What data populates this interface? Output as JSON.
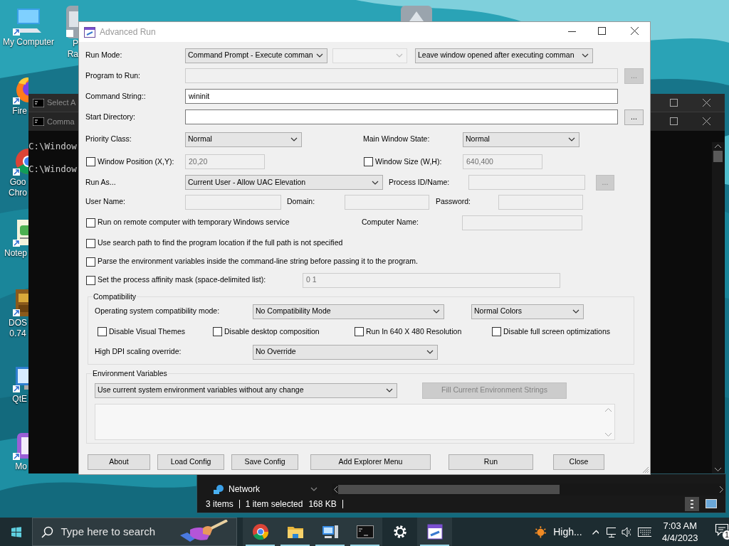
{
  "desktop_icons": [
    {
      "kind": "computer",
      "lines": [
        "My Computer"
      ]
    },
    {
      "kind": "firefox",
      "lines": [
        "Fire"
      ]
    },
    {
      "kind": "browser",
      "lines": [
        "Goo",
        "Chro"
      ]
    },
    {
      "kind": "notepad",
      "lines": [
        "Notep"
      ]
    },
    {
      "kind": "dos",
      "lines": [
        "DOS",
        "0.74"
      ]
    },
    {
      "kind": "monitor",
      "lines": [
        "QtE"
      ]
    },
    {
      "kind": "purple",
      "lines": [
        "Mo"
      ]
    }
  ],
  "top_icon": {
    "lines": [
      "P",
      "Ra"
    ]
  },
  "console_windows": [
    {
      "title": "Select A"
    },
    {
      "title": "Comma"
    }
  ],
  "console_lines": [
    "C:\\Window",
    "C:\\Window"
  ],
  "dialog": {
    "title": "Advanced Run",
    "run_mode": {
      "label": "Run Mode:",
      "mode": {
        "value": "Command Prompt - Execute comman",
        "disabled": false
      },
      "option2": {
        "disabled": true
      },
      "window_option": {
        "value": "Leave window opened after executing comman",
        "disabled": false
      }
    },
    "program": {
      "label": "Program to Run:",
      "disabled": true,
      "browse": {
        "label": "...",
        "disabled": true
      }
    },
    "command": {
      "label": "Command String::",
      "value": "wininit",
      "disabled": false
    },
    "start_dir": {
      "label": "Start Directory:",
      "disabled": false,
      "browse": {
        "label": "...",
        "disabled": false
      }
    },
    "priority": {
      "label": "Priority Class:",
      "value": "Normal"
    },
    "main_window_state": {
      "label": "Main Window State:",
      "value": "Normal"
    },
    "window_position": {
      "label": "Window Position (X,Y):",
      "checked": false,
      "value": "20,20",
      "disabled": true
    },
    "window_size": {
      "label": "Window Size (W,H):",
      "checked": false,
      "value": "640,400",
      "disabled": true
    },
    "run_as": {
      "label": "Run As...",
      "value": "Current User - Allow UAC Elevation"
    },
    "process": {
      "label": "Process ID/Name:",
      "disabled": true,
      "browse": {
        "label": "...",
        "disabled": true
      }
    },
    "user_name": {
      "label": "User Name:",
      "disabled": true
    },
    "domain": {
      "label": "Domain:",
      "disabled": true
    },
    "password": {
      "label": "Password:",
      "disabled": true
    },
    "options": [
      {
        "label": "Run on remote computer with temporary Windows service",
        "checked": false
      },
      {
        "label": "Use search path to find the program location if the full path is not specified",
        "checked": false
      },
      {
        "label": "Parse the environment variables inside the command-line string before passing it to the program.",
        "checked": false
      },
      {
        "label": "Set the process affinity mask (space-delimited list):",
        "checked": false
      }
    ],
    "computer_name": {
      "label": "Computer Name:",
      "disabled": true
    },
    "affinity": {
      "value": "0 1",
      "disabled": true
    },
    "compatibility": {
      "title": "Compatibility",
      "os_mode": {
        "label": "Operating system compatibility mode:",
        "value": "No Compatibility Mode"
      },
      "colors": {
        "value": "Normal Colors"
      },
      "options": [
        {
          "label": "Disable Visual Themes",
          "checked": false
        },
        {
          "label": "Disable desktop composition",
          "checked": false
        },
        {
          "label": "Run In 640 X 480 Resolution",
          "checked": false
        },
        {
          "label": "Disable full screen optimizations",
          "checked": false
        }
      ],
      "dpi": {
        "label": "High DPI scaling override:",
        "value": "No Override"
      }
    },
    "environment": {
      "title": "Environment Variables",
      "mode": {
        "value": "Use current system environment variables without any change"
      },
      "fill_button": {
        "label": "Fill Current Environment Strings",
        "disabled": true
      }
    },
    "buttons": [
      {
        "label": "About"
      },
      {
        "label": "Load Config"
      },
      {
        "label": "Save Config"
      },
      {
        "label": "Add Explorer Menu"
      },
      {
        "label": "Run"
      },
      {
        "label": "Close"
      }
    ]
  },
  "explorer": {
    "nav_item": "Network",
    "status": [
      "3 items",
      "1 item selected",
      "168 KB"
    ]
  },
  "taskbar": {
    "search": {
      "placeholder": "Type here to search"
    },
    "pinned": [
      {
        "kind": "browser",
        "running": true
      },
      {
        "kind": "folder",
        "running": true
      },
      {
        "kind": "computer",
        "running": true
      },
      {
        "kind": "terminal",
        "running": true
      },
      {
        "kind": "gear",
        "running": false
      },
      {
        "kind": "app",
        "running": true
      }
    ],
    "weather": "High...",
    "time": "7:03 AM",
    "date": "4/4/2023",
    "notifications": "1"
  }
}
